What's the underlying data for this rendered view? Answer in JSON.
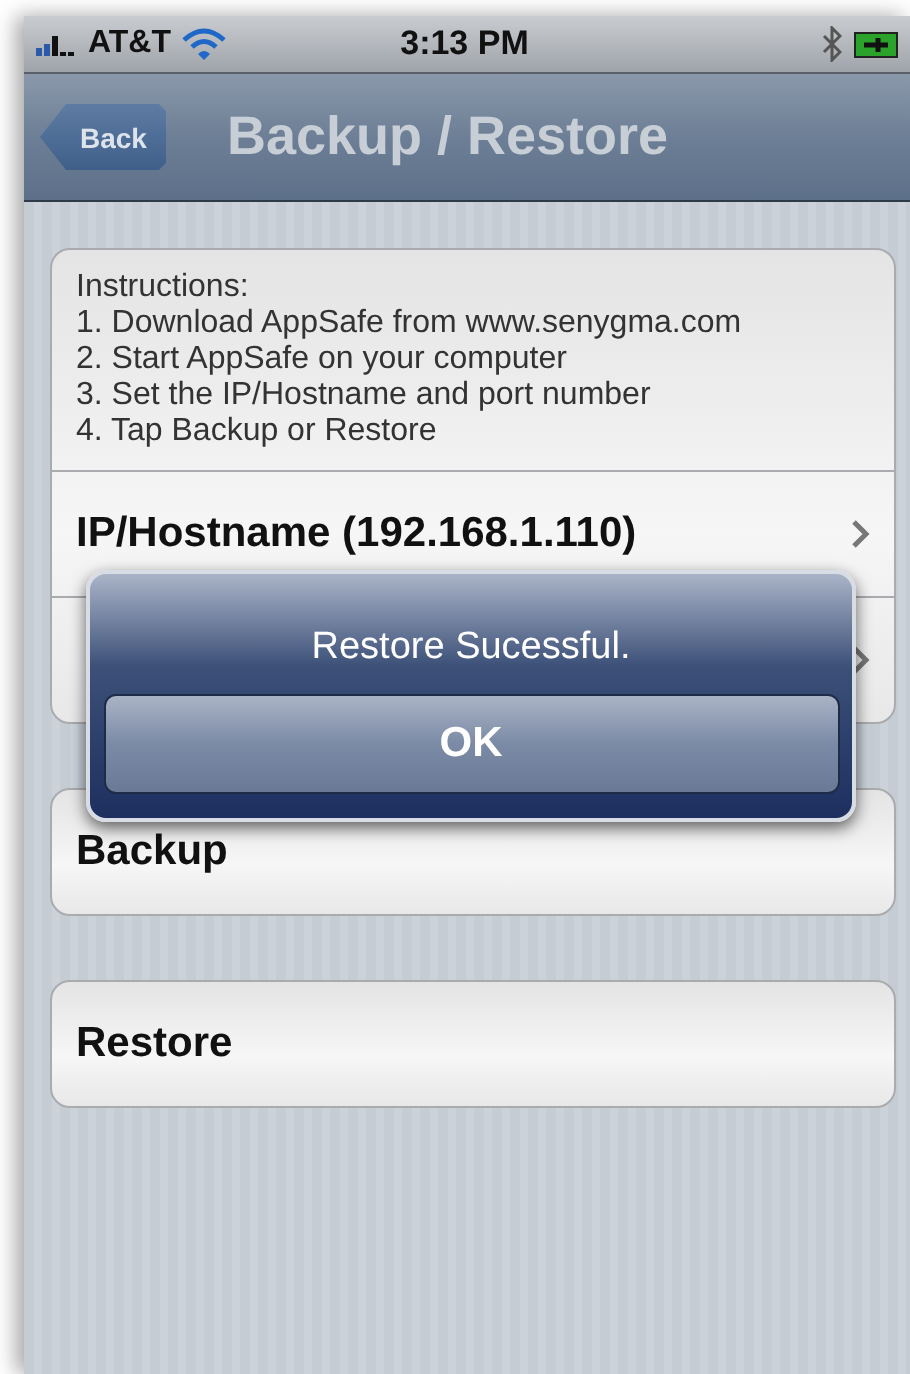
{
  "status_bar": {
    "carrier": "AT&T",
    "time": "3:13 PM"
  },
  "nav_bar": {
    "back_label": "Back",
    "title": "Backup / Restore"
  },
  "instructions": [
    "Instructions:",
    "1. Download AppSafe from www.senygma.com",
    "2. Start AppSafe on your computer",
    "3. Set the IP/Hostname and port number",
    "4. Tap Backup or Restore"
  ],
  "settings": [
    {
      "label": "IP/Hostname (192.168.1.110)",
      "chevron": true
    },
    {
      "chevron": true
    }
  ],
  "actions": [
    {
      "label": "Backup"
    },
    {
      "label": "Restore"
    }
  ],
  "alert": {
    "message": "Restore Sucessful.",
    "button": "OK"
  }
}
